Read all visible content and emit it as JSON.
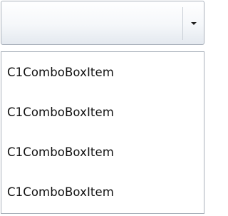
{
  "combo": {
    "selected_text": "",
    "dropdown_open": true
  },
  "items": [
    {
      "label": "C1ComboBoxItem"
    },
    {
      "label": "C1ComboBoxItem"
    },
    {
      "label": "C1ComboBoxItem"
    },
    {
      "label": "C1ComboBoxItem"
    }
  ],
  "icons": {
    "dropdown_arrow": "chevron-down-icon"
  },
  "colors": {
    "border": "#a9b1bb",
    "text": "#111111",
    "header_gradient_bottom": "#e4e9ef"
  }
}
